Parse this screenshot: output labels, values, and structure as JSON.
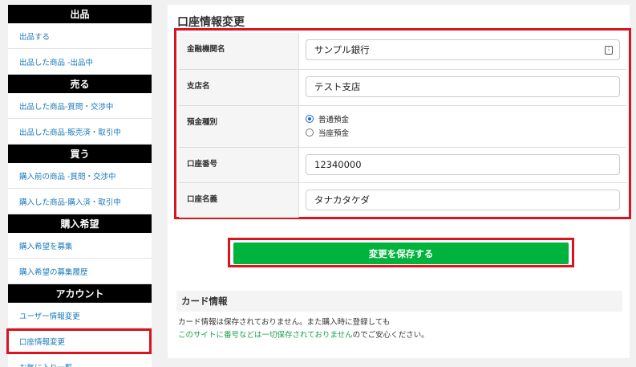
{
  "sidebar": {
    "sections": [
      {
        "title": "出品",
        "items": [
          "出品する",
          "出品した商品 -出品中"
        ]
      },
      {
        "title": "売る",
        "items": [
          "出品した商品-質問・交渉中",
          "出品した商品-販売済・取引中"
        ]
      },
      {
        "title": "買う",
        "items": [
          "購入前の商品 -質問・交渉中",
          "購入した商品-購入済・取引中"
        ]
      },
      {
        "title": "購入希望",
        "items": [
          "購入希望を募集",
          "購入希望の募集履歴"
        ]
      },
      {
        "title": "アカウント",
        "items": [
          "ユーザー情報変更",
          "口座情報変更",
          "お気に入り一覧"
        ]
      }
    ]
  },
  "main": {
    "title": "口座情報変更",
    "form": {
      "bank_label": "金融機関名",
      "bank_value": "サンプル銀行",
      "branch_label": "支店名",
      "branch_value": "テスト支店",
      "type_label": "預金種別",
      "type_option1": "普通預金",
      "type_option2": "当座預金",
      "number_label": "口座番号",
      "number_value": "12340000",
      "holder_label": "口座名義",
      "holder_value": "タナカタケダ"
    },
    "save_label": "変更を保存する",
    "card": {
      "heading": "カード情報",
      "line1": "カード情報は保存されておりません。また購入時に登録しても",
      "line2_green": "このサイトに番号などは一切保存されておりません",
      "line2_rest": "のでご安心ください。"
    }
  },
  "colors": {
    "accent_green": "#00b33c",
    "highlight_red": "#d9141e",
    "link_blue": "#1a7bb9"
  }
}
